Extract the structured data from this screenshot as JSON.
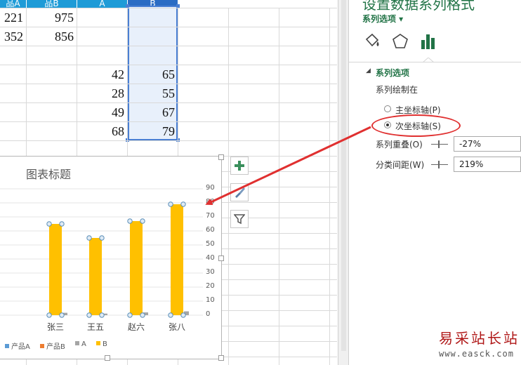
{
  "sheet": {
    "columns": [
      {
        "label": "品A"
      },
      {
        "label": "品B"
      },
      {
        "label": "A"
      },
      {
        "label": "B"
      }
    ],
    "rows": [
      {
        "c1": "221",
        "c2": "975",
        "c3": "",
        "c4": ""
      },
      {
        "c1": "352",
        "c2": "856",
        "c3": "",
        "c4": ""
      },
      {
        "c1": "",
        "c2": "",
        "c3": "",
        "c4": ""
      },
      {
        "c1": "",
        "c2": "",
        "c3": "42",
        "c4": "65"
      },
      {
        "c1": "",
        "c2": "",
        "c3": "28",
        "c4": "55"
      },
      {
        "c1": "",
        "c2": "",
        "c3": "49",
        "c4": "67"
      },
      {
        "c1": "",
        "c2": "",
        "c3": "68",
        "c4": "79"
      }
    ]
  },
  "chart_data": {
    "type": "bar",
    "title": "图表标题",
    "categories": [
      "张三",
      "王五",
      "赵六",
      "张八"
    ],
    "series": [
      {
        "name": "产品A",
        "values": [
          0,
          0,
          0,
          0
        ],
        "color": "#5b9bd5"
      },
      {
        "name": "产品B",
        "values": [
          0,
          0,
          0,
          0
        ],
        "color": "#ed7d31"
      },
      {
        "name": "A",
        "values": [
          42,
          28,
          49,
          68
        ],
        "color": "#a5a5a5"
      },
      {
        "name": "B",
        "values": [
          65,
          55,
          67,
          79
        ],
        "color": "#ffc000"
      }
    ],
    "secondary_axis": {
      "ticks": [
        "0",
        "10",
        "20",
        "30",
        "40",
        "50",
        "60",
        "70",
        "80",
        "90"
      ],
      "ylim": [
        0,
        90
      ]
    },
    "legend_position": "bottom"
  },
  "chart_buttons": [
    {
      "icon": "plus-icon"
    },
    {
      "icon": "brush-icon"
    },
    {
      "icon": "filter-icon"
    }
  ],
  "pane": {
    "title": "设置数据系列格式",
    "options_label": "系列选项 ▾",
    "tabs": [
      {
        "icon": "fill-bucket-icon"
      },
      {
        "icon": "pentagon-icon"
      },
      {
        "icon": "bar-chart-icon"
      }
    ],
    "section_title": "系列选项",
    "plot_on_label": "系列绘制在",
    "primary_axis": "主坐标轴(P)",
    "secondary_axis": "次坐标轴(S)",
    "overlap_label": "系列重叠(O)",
    "overlap_value": "-27%",
    "gap_label": "分类间距(W)",
    "gap_value": "219%",
    "accent": "#217346"
  },
  "watermark": {
    "text": "易采站长站",
    "url": "www.easck.com"
  }
}
